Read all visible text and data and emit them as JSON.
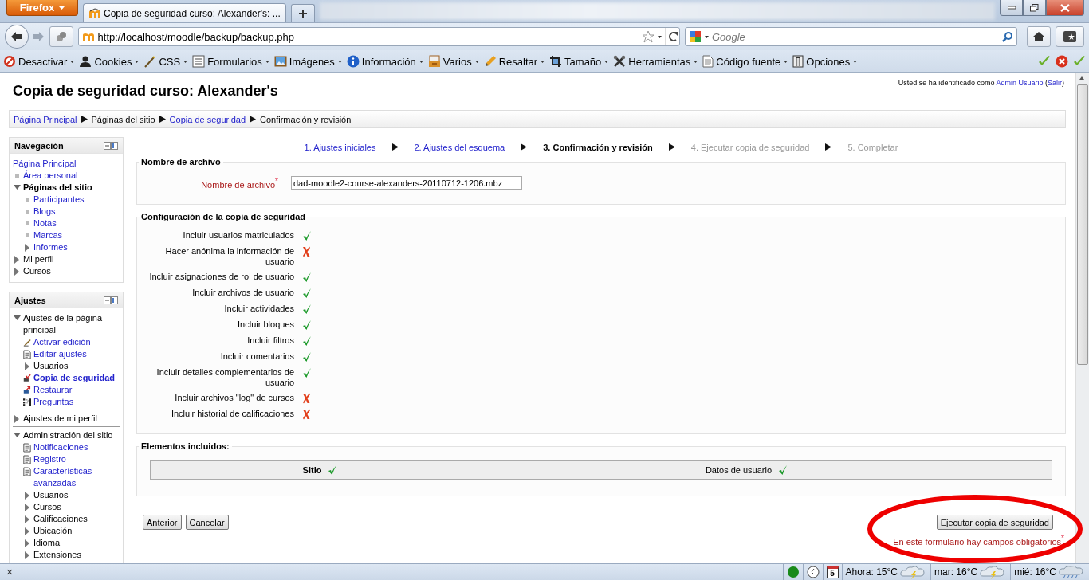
{
  "browser": {
    "menu_button": "Firefox",
    "tab": {
      "title": "Copia de seguridad curso: Alexander's: ..."
    },
    "url": "http://localhost/moodle/backup/backup.php",
    "search": {
      "placeholder": "Google"
    },
    "toolbar": [
      {
        "label": "Desactivar",
        "kind": "disable"
      },
      {
        "label": "Cookies",
        "kind": "cookies"
      },
      {
        "label": "CSS",
        "kind": "css"
      },
      {
        "label": "Formularios",
        "kind": "forms"
      },
      {
        "label": "Imágenes",
        "kind": "images"
      },
      {
        "label": "Información",
        "kind": "info"
      },
      {
        "label": "Varios",
        "kind": "misc"
      },
      {
        "label": "Resaltar",
        "kind": "highlight"
      },
      {
        "label": "Tamaño",
        "kind": "resize"
      },
      {
        "label": "Herramientas",
        "kind": "tools"
      },
      {
        "label": "Código fuente",
        "kind": "source"
      },
      {
        "label": "Opciones",
        "kind": "options"
      }
    ]
  },
  "page": {
    "title": "Copia de seguridad curso: Alexander's",
    "login": {
      "text": "Usted se ha identificado como",
      "user": "Admin Usuario",
      "open": "(",
      "logout": "Salir",
      "close": ")"
    },
    "breadcrumb": [
      {
        "label": "Página Principal",
        "link": true
      },
      {
        "label": "Páginas del sitio",
        "link": false
      },
      {
        "label": "Copia de seguridad",
        "link": true
      },
      {
        "label": "Confirmación y revisión",
        "link": false
      }
    ],
    "sidebar": [
      {
        "title": "Navegación",
        "separated": false,
        "items": [
          {
            "label": "Página Principal",
            "kind": "none",
            "link": true,
            "active": false
          },
          {
            "label": "Área personal",
            "kind": "dot",
            "link": true,
            "active": false
          },
          {
            "label": "Páginas del sitio",
            "kind": "expanded",
            "link": false,
            "active": true,
            "children": [
              {
                "label": "Participantes",
                "kind": "dot",
                "link": true,
                "active": false
              },
              {
                "label": "Blogs",
                "kind": "dot",
                "link": true,
                "active": false
              },
              {
                "label": "Notas",
                "kind": "dot",
                "link": true,
                "active": false
              },
              {
                "label": "Marcas",
                "kind": "dot",
                "link": true,
                "active": false
              },
              {
                "label": "Informes",
                "kind": "collapsed",
                "link": true,
                "active": false
              }
            ]
          },
          {
            "label": "Mi perfil",
            "kind": "collapsed",
            "link": false,
            "active": false
          },
          {
            "label": "Cursos",
            "kind": "collapsed",
            "link": false,
            "active": false
          }
        ]
      },
      {
        "title": "Ajustes",
        "separated": true,
        "items": [
          {
            "label": "Ajustes de la página principal",
            "kind": "expanded",
            "link": false,
            "active": false,
            "children": [
              {
                "label": "Activar edición",
                "kind": "edit",
                "link": true,
                "active": false
              },
              {
                "label": "Editar ajustes",
                "kind": "doc",
                "link": true,
                "active": false
              },
              {
                "label": "Usuarios",
                "kind": "collapsed",
                "link": false,
                "active": false
              },
              {
                "label": "Copia de seguridad",
                "kind": "backup",
                "link": true,
                "active": true
              },
              {
                "label": "Restaurar",
                "kind": "restore",
                "link": true,
                "active": false
              },
              {
                "label": "Preguntas",
                "kind": "questions",
                "link": true,
                "active": false
              }
            ]
          },
          {
            "label": "Ajustes de mi perfil",
            "kind": "collapsed",
            "link": false,
            "active": false
          },
          {
            "label": "Administración del sitio",
            "kind": "expanded",
            "link": false,
            "active": false,
            "children": [
              {
                "label": "Notificaciones",
                "kind": "doc",
                "link": true,
                "active": false
              },
              {
                "label": "Registro",
                "kind": "doc",
                "link": true,
                "active": false
              },
              {
                "label": "Características avanzadas",
                "kind": "doc",
                "link": true,
                "active": false
              },
              {
                "label": "Usuarios",
                "kind": "collapsed",
                "link": false,
                "active": false
              },
              {
                "label": "Cursos",
                "kind": "collapsed",
                "link": false,
                "active": false
              },
              {
                "label": "Calificaciones",
                "kind": "collapsed",
                "link": false,
                "active": false
              },
              {
                "label": "Ubicación",
                "kind": "collapsed",
                "link": false,
                "active": false
              },
              {
                "label": "Idioma",
                "kind": "collapsed",
                "link": false,
                "active": false
              },
              {
                "label": "Extensiones",
                "kind": "collapsed",
                "link": false,
                "active": false
              }
            ]
          }
        ]
      }
    ],
    "steps": [
      {
        "label": "1. Ajustes iniciales",
        "selected": false,
        "disabled": false
      },
      {
        "label": "2. Ajustes del esquema",
        "selected": false,
        "disabled": false
      },
      {
        "label": "3. Confirmación y revisión",
        "selected": true,
        "disabled": false
      },
      {
        "label": "4. Ejecutar copia de seguridad",
        "selected": false,
        "disabled": true
      },
      {
        "label": "5. Completar",
        "selected": false,
        "disabled": true
      }
    ],
    "filename_section": {
      "legend": "Nombre de archivo",
      "label": "Nombre de archivo",
      "required_mark": "*",
      "value": "dad-moodle2-course-alexanders-20110712-1206.mbz"
    },
    "settings_section": {
      "legend": "Configuración de la copia de seguridad",
      "settings": [
        {
          "label": "Incluir usuarios matriculados",
          "checked": true
        },
        {
          "label": "Hacer anónima la información de usuario",
          "checked": false
        },
        {
          "label": "Incluir asignaciones de rol de usuario",
          "checked": true
        },
        {
          "label": "Incluir archivos de usuario",
          "checked": true
        },
        {
          "label": "Incluir actividades",
          "checked": true
        },
        {
          "label": "Incluir bloques",
          "checked": true
        },
        {
          "label": "Incluir filtros",
          "checked": true
        },
        {
          "label": "Incluir comentarios",
          "checked": true
        },
        {
          "label": "Incluir detalles complementarios de usuario",
          "checked": true
        },
        {
          "label": "Incluir archivos \"log\" de cursos",
          "checked": false
        },
        {
          "label": "Incluir historial de calificaciones",
          "checked": false
        }
      ]
    },
    "included_section": {
      "legend": "Elementos incluidos:",
      "items": [
        {
          "label": "Sitio",
          "checked": true
        },
        {
          "label": "Datos de usuario",
          "checked": true
        }
      ]
    },
    "buttons": {
      "previous": "Anterior",
      "cancel": "Cancelar",
      "submit": "Ejecutar copia de seguridad"
    },
    "required_note": {
      "text": "En este formulario hay campos obligatorios",
      "mark": "*"
    }
  },
  "status_bar": {
    "close": "×",
    "calendar_day": "5",
    "weather": [
      {
        "label": "Ahora: 15°C",
        "kind": "storm"
      },
      {
        "label": "mar: 16°C",
        "kind": "storm"
      },
      {
        "label": "mié: 16°C",
        "kind": "rain"
      }
    ]
  }
}
